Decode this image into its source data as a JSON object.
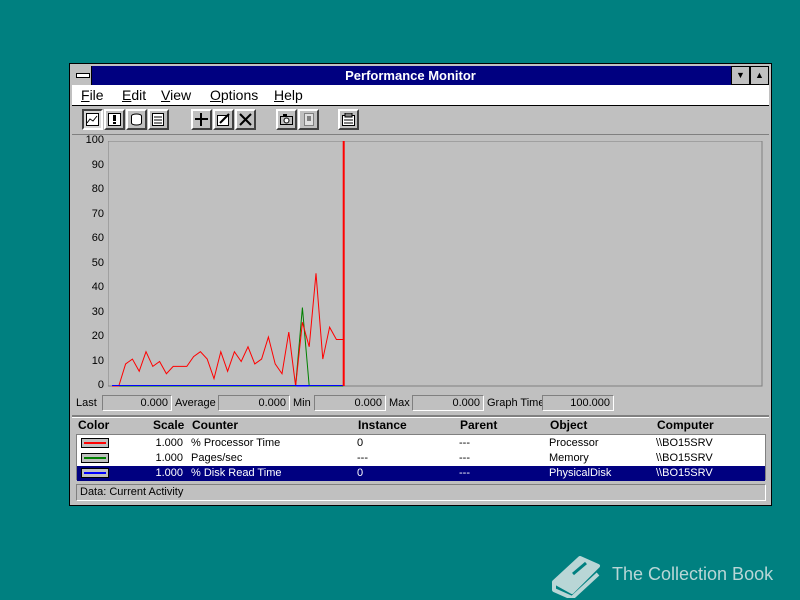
{
  "window": {
    "title": "Performance Monitor"
  },
  "menu": [
    {
      "label": "File",
      "key": "F",
      "rest": "ile"
    },
    {
      "label": "Edit",
      "key": "E",
      "rest": "dit"
    },
    {
      "label": "View",
      "key": "V",
      "rest": "iew"
    },
    {
      "label": "Options",
      "key": "O",
      "rest": "ptions"
    },
    {
      "label": "Help",
      "key": "H",
      "rest": "elp"
    }
  ],
  "toolbar": {
    "buttons": [
      "chart-view",
      "alert-view",
      "log-view",
      "report-view",
      "add-counter",
      "edit-counter",
      "delete-counter",
      "update-now",
      "bookmark",
      "options"
    ]
  },
  "chart_data": {
    "type": "line",
    "ylim": [
      0,
      100
    ],
    "yticks": [
      "100",
      "90",
      "80",
      "70",
      "60",
      "50",
      "40",
      "30",
      "20",
      "10",
      "0"
    ],
    "grid": false,
    "time_cursor_index": 34,
    "x": [
      0,
      1,
      2,
      3,
      4,
      5,
      6,
      7,
      8,
      9,
      10,
      11,
      12,
      13,
      14,
      15,
      16,
      17,
      18,
      19,
      20,
      21,
      22,
      23,
      24,
      25,
      26,
      27,
      28,
      29,
      30,
      31,
      32,
      33,
      34
    ],
    "series": [
      {
        "name": "% Processor Time",
        "color": "#ff0000",
        "values": [
          0,
          0,
          9,
          11,
          6,
          14,
          8,
          10,
          5,
          8,
          8,
          8,
          12,
          14,
          11,
          3,
          14,
          6,
          14,
          10,
          16,
          9,
          11,
          20,
          9,
          5,
          22,
          0,
          26,
          16,
          46,
          11,
          24,
          19,
          19
        ]
      },
      {
        "name": "Pages/sec",
        "color": "#008000",
        "values": [
          0,
          0,
          0,
          0,
          0,
          0,
          0,
          0,
          0,
          0,
          0,
          0,
          0,
          0,
          0,
          0,
          0,
          0,
          0,
          0,
          0,
          0,
          0,
          0,
          0,
          0,
          0,
          0,
          32,
          0,
          0,
          0,
          0,
          0,
          0
        ]
      },
      {
        "name": "% Disk Read Time",
        "color": "#0000ff",
        "values": [
          0,
          0,
          0,
          0,
          0,
          0,
          0,
          0,
          0,
          0,
          0,
          0,
          0,
          0,
          0,
          0,
          0,
          0,
          0,
          0,
          0,
          0,
          0,
          0,
          0,
          0,
          0,
          0,
          0,
          0,
          0,
          0,
          0,
          0,
          0
        ]
      }
    ]
  },
  "stats": {
    "last_label": "Last",
    "last": "0.000",
    "avg_label": "Average",
    "avg": "0.000",
    "min_label": "Min",
    "min": "0.000",
    "max_label": "Max",
    "max": "0.000",
    "graph_time_label": "Graph Time",
    "graph_time": "100.000"
  },
  "legend": {
    "headers": {
      "color": "Color",
      "scale": "Scale",
      "counter": "Counter",
      "instance": "Instance",
      "parent": "Parent",
      "object": "Object",
      "computer": "Computer"
    },
    "rows": [
      {
        "color": "#ff0000",
        "scale": "1.000",
        "counter": "% Processor Time",
        "instance": "0",
        "parent": "---",
        "object": "Processor",
        "computer": "\\\\BO15SRV"
      },
      {
        "color": "#008000",
        "scale": "1.000",
        "counter": "Pages/sec",
        "instance": "---",
        "parent": "---",
        "object": "Memory",
        "computer": "\\\\BO15SRV"
      },
      {
        "color": "#0000ff",
        "scale": "1.000",
        "counter": "% Disk Read Time",
        "instance": "0",
        "parent": "---",
        "object": "PhysicalDisk",
        "computer": "\\\\BO15SRV"
      }
    ],
    "selected_row": 2
  },
  "status": {
    "text": "Data: Current Activity"
  },
  "brand": {
    "text": "The Collection Book"
  }
}
